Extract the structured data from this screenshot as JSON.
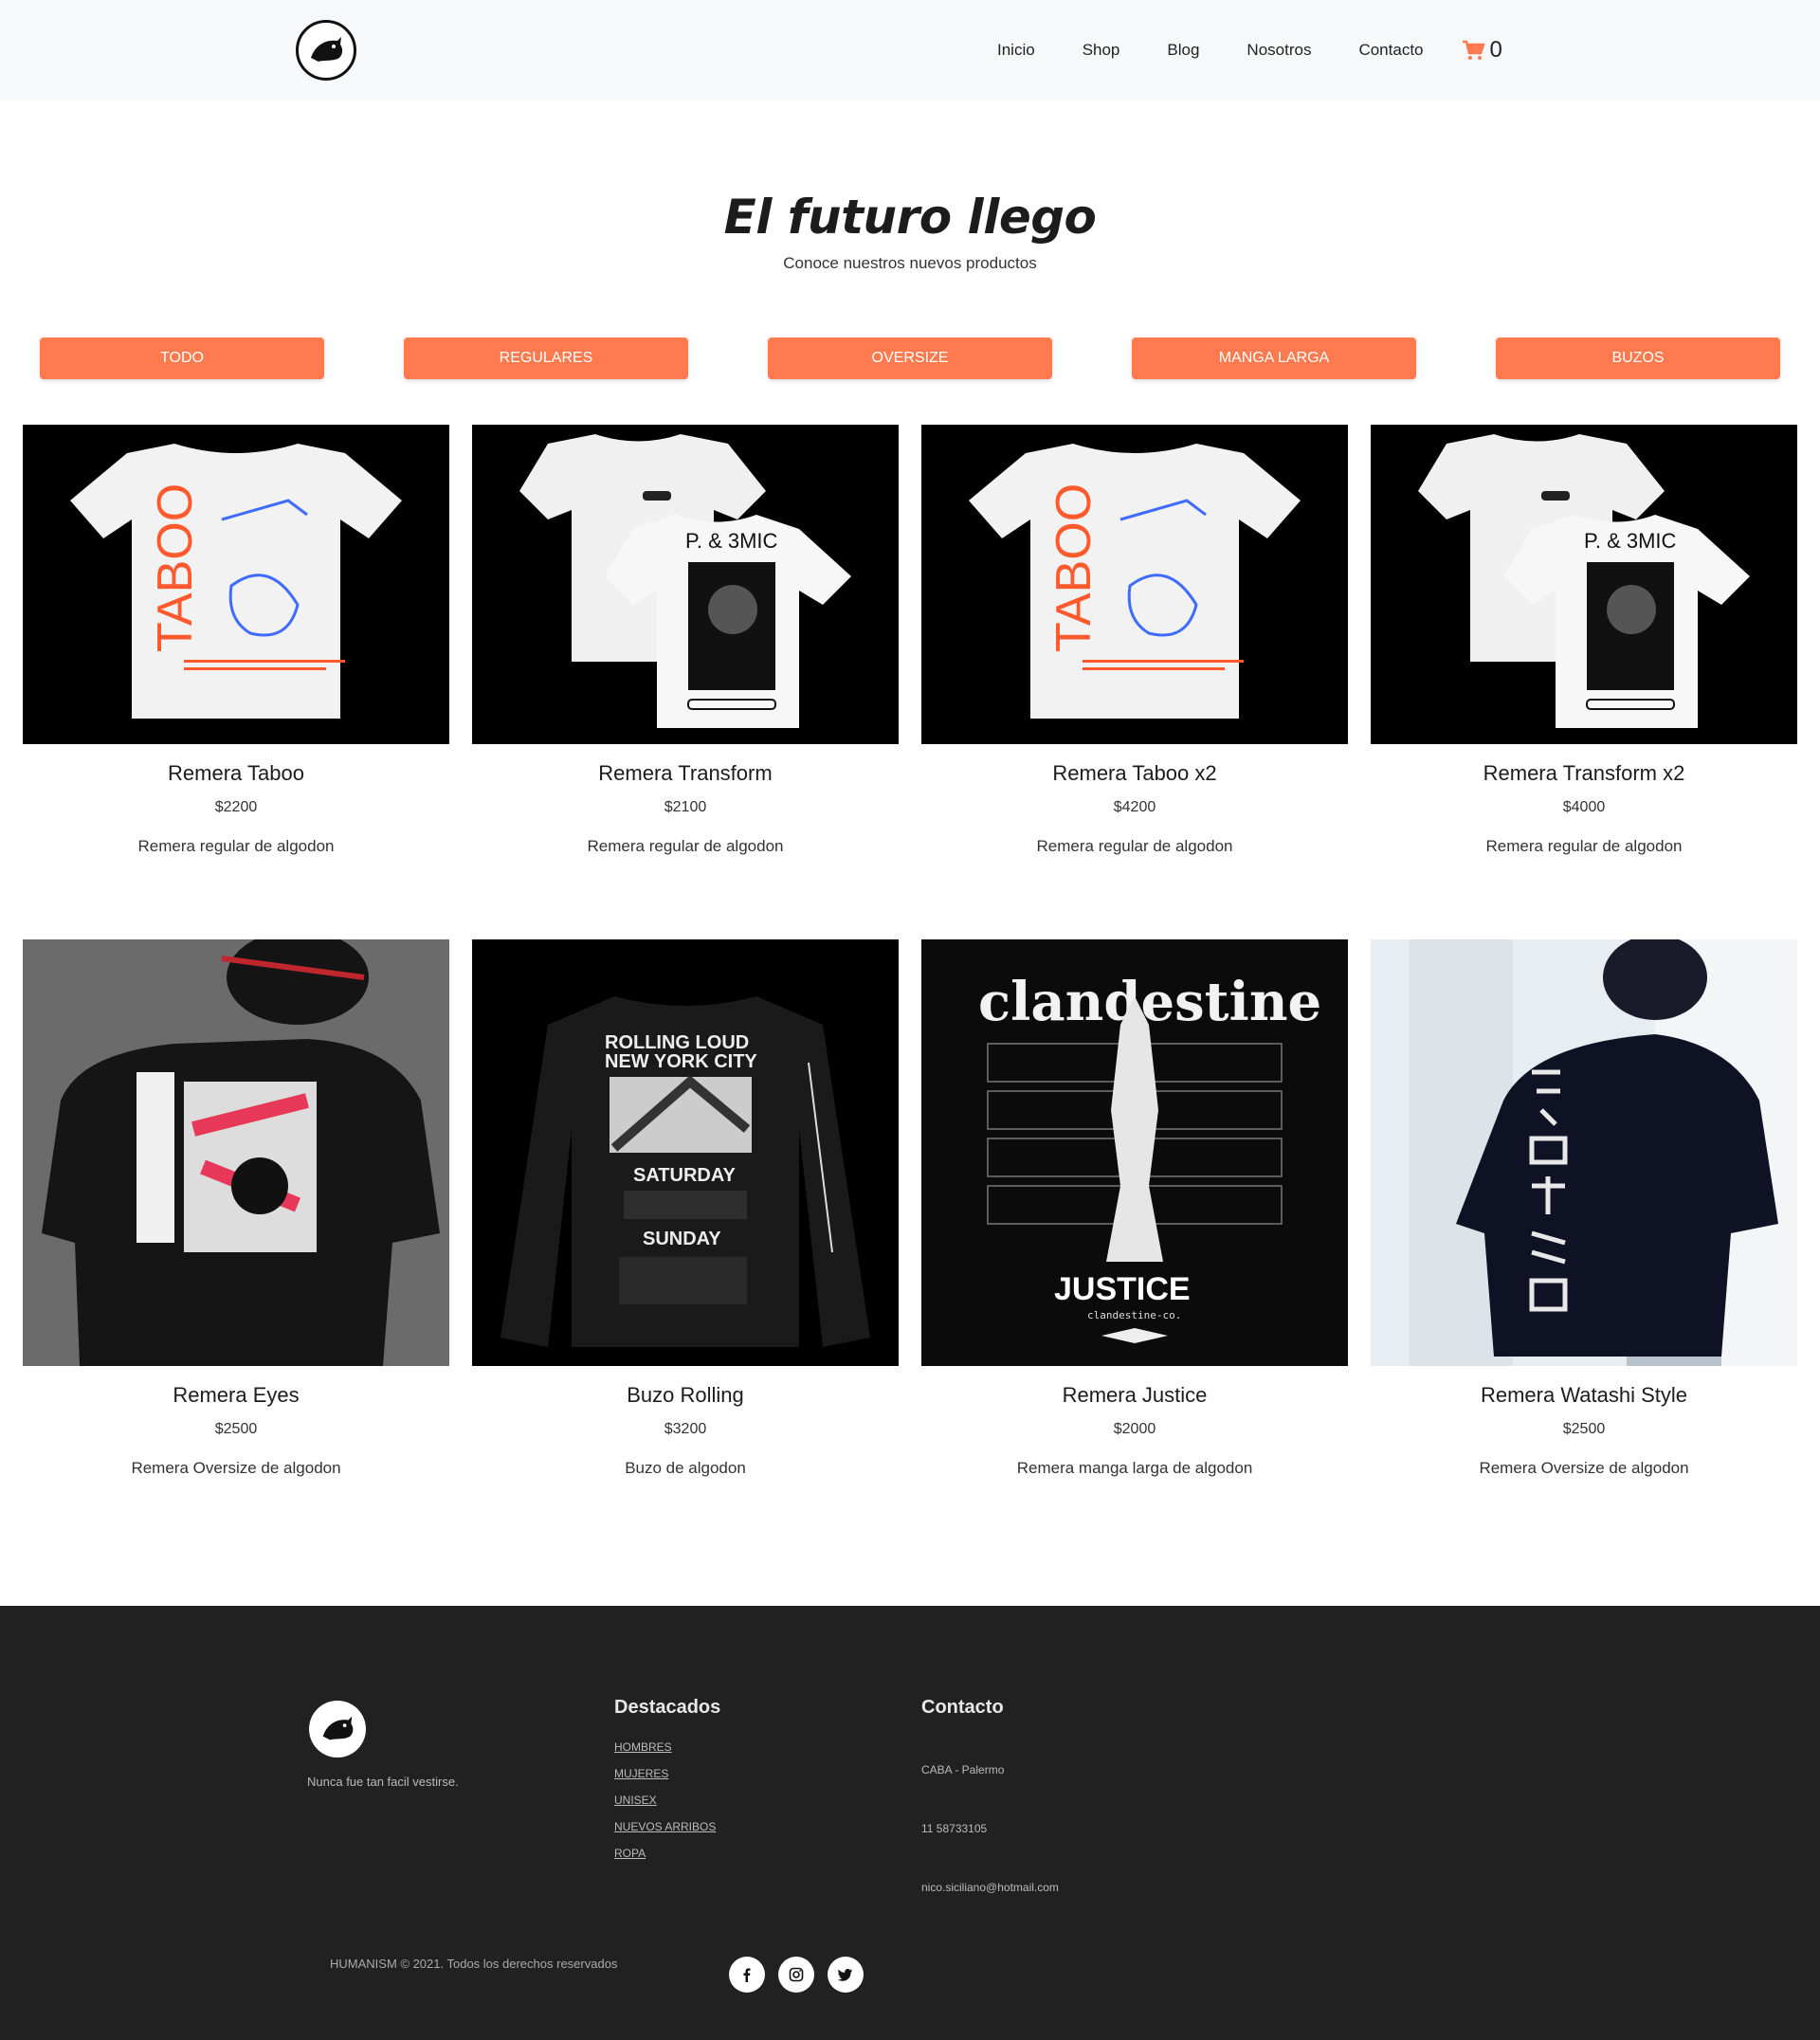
{
  "header": {
    "nav": [
      "Inicio",
      "Shop",
      "Blog",
      "Nosotros",
      "Contacto"
    ],
    "cart_count": "0"
  },
  "hero": {
    "title": "El futuro llego",
    "subtitle": "Conoce nuestros nuevos productos"
  },
  "filters": [
    "TODO",
    "REGULARES",
    "OVERSIZE",
    "MANGA LARGA",
    "BUZOS"
  ],
  "products": [
    {
      "name": "Remera Taboo",
      "price": "$2200",
      "desc": "Remera regular de algodon",
      "art_text": "TABOO"
    },
    {
      "name": "Remera Transform",
      "price": "$2100",
      "desc": "Remera regular de algodon",
      "art_text": "P. & 3MIC"
    },
    {
      "name": "Remera Taboo x2",
      "price": "$4200",
      "desc": "Remera regular de algodon",
      "art_text": "TABOO"
    },
    {
      "name": "Remera Transform x2",
      "price": "$4000",
      "desc": "Remera regular de algodon",
      "art_text": "P. & 3MIC"
    },
    {
      "name": "Remera Eyes",
      "price": "$2500",
      "desc": "Remera Oversize de algodon"
    },
    {
      "name": "Buzo Rolling",
      "price": "$3200",
      "desc": "Buzo de algodon",
      "art_lines": [
        "ROLLING LOUD",
        "NEW YORK CITY",
        "SATURDAY",
        "SUNDAY"
      ]
    },
    {
      "name": "Remera Justice",
      "price": "$2000",
      "desc": "Remera manga larga de algodon",
      "art_lines": [
        "clandestine",
        "JUSTICE",
        "clandestine-co."
      ]
    },
    {
      "name": "Remera Watashi Style",
      "price": "$2500",
      "desc": "Remera Oversize de algodon"
    }
  ],
  "footer": {
    "tagline": "Nunca fue tan facil vestirse.",
    "featured_title": "Destacados",
    "featured_links": [
      "HOMBRES",
      "MUJERES",
      "UNISEX",
      "NUEVOS ARRIBOS",
      "ROPA"
    ],
    "contact_title": "Contacto",
    "contact": [
      "CABA - Palermo",
      "11 58733105",
      "nico.siciliano@hotmail.com"
    ],
    "copyright": "HUMANISM © 2021. Todos los derechos reservados"
  },
  "colors": {
    "accent": "#ff7a4f",
    "footer_bg": "#212121"
  },
  "icons": [
    "panther-logo-icon",
    "cart-icon",
    "facebook-icon",
    "instagram-icon",
    "twitter-icon"
  ]
}
